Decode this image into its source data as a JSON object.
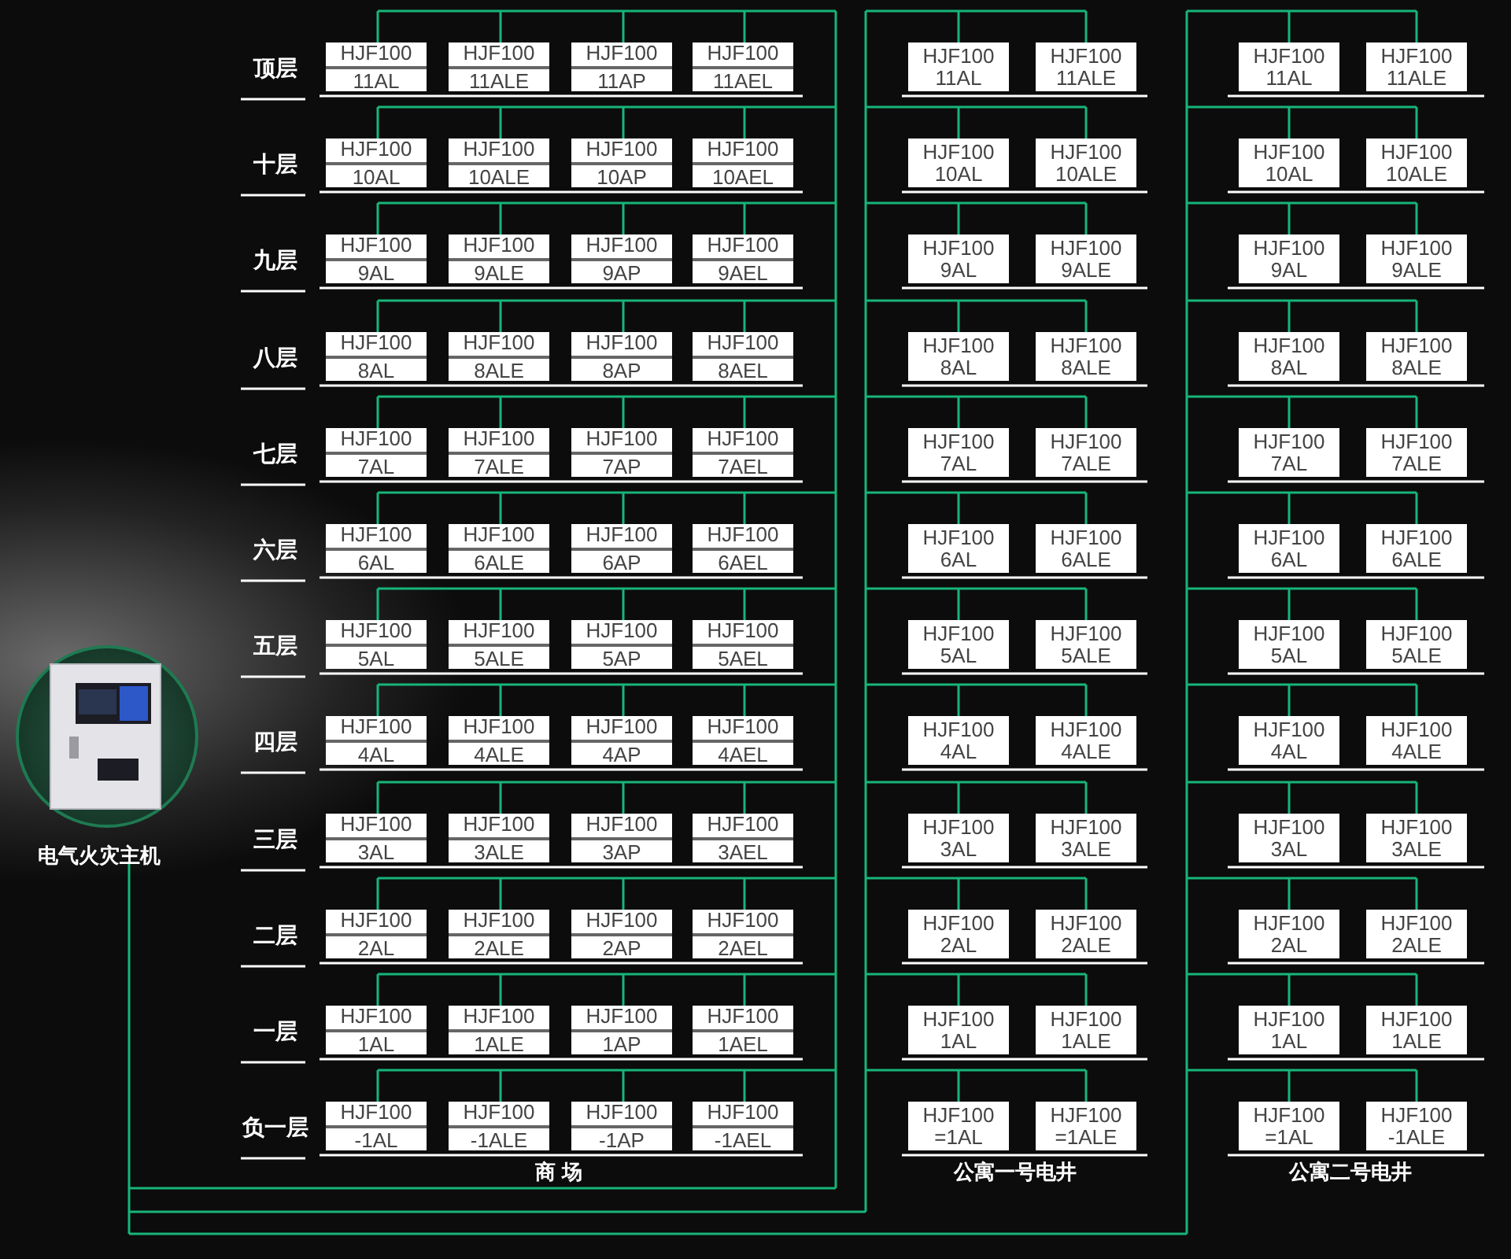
{
  "host": {
    "label": "电气火灾主机"
  },
  "sections": {
    "mall": "商 场",
    "apartment_1": "公寓一号电井",
    "apartment_2": "公寓二号电井"
  },
  "floors": [
    {
      "label": "顶层",
      "mall": [
        {
          "model": "HJF100",
          "code": "11AL"
        },
        {
          "model": "HJF100",
          "code": "11ALE"
        },
        {
          "model": "HJF100",
          "code": "11AP"
        },
        {
          "model": "HJF100",
          "code": "11AEL"
        }
      ],
      "apartment_1": [
        {
          "model": "HJF100",
          "code": "11AL"
        },
        {
          "model": "HJF100",
          "code": "11ALE"
        }
      ],
      "apartment_2": [
        {
          "model": "HJF100",
          "code": "11AL"
        },
        {
          "model": "HJF100",
          "code": "11ALE"
        }
      ]
    },
    {
      "label": "十层",
      "mall": [
        {
          "model": "HJF100",
          "code": "10AL"
        },
        {
          "model": "HJF100",
          "code": "10ALE"
        },
        {
          "model": "HJF100",
          "code": "10AP"
        },
        {
          "model": "HJF100",
          "code": "10AEL"
        }
      ],
      "apartment_1": [
        {
          "model": "HJF100",
          "code": "10AL"
        },
        {
          "model": "HJF100",
          "code": "10ALE"
        }
      ],
      "apartment_2": [
        {
          "model": "HJF100",
          "code": "10AL"
        },
        {
          "model": "HJF100",
          "code": "10ALE"
        }
      ]
    },
    {
      "label": "九层",
      "mall": [
        {
          "model": "HJF100",
          "code": "9AL"
        },
        {
          "model": "HJF100",
          "code": "9ALE"
        },
        {
          "model": "HJF100",
          "code": "9AP"
        },
        {
          "model": "HJF100",
          "code": "9AEL"
        }
      ],
      "apartment_1": [
        {
          "model": "HJF100",
          "code": "9AL"
        },
        {
          "model": "HJF100",
          "code": "9ALE"
        }
      ],
      "apartment_2": [
        {
          "model": "HJF100",
          "code": "9AL"
        },
        {
          "model": "HJF100",
          "code": "9ALE"
        }
      ]
    },
    {
      "label": "八层",
      "mall": [
        {
          "model": "HJF100",
          "code": "8AL"
        },
        {
          "model": "HJF100",
          "code": "8ALE"
        },
        {
          "model": "HJF100",
          "code": "8AP"
        },
        {
          "model": "HJF100",
          "code": "8AEL"
        }
      ],
      "apartment_1": [
        {
          "model": "HJF100",
          "code": "8AL"
        },
        {
          "model": "HJF100",
          "code": "8ALE"
        }
      ],
      "apartment_2": [
        {
          "model": "HJF100",
          "code": "8AL"
        },
        {
          "model": "HJF100",
          "code": "8ALE"
        }
      ]
    },
    {
      "label": "七层",
      "mall": [
        {
          "model": "HJF100",
          "code": "7AL"
        },
        {
          "model": "HJF100",
          "code": "7ALE"
        },
        {
          "model": "HJF100",
          "code": "7AP"
        },
        {
          "model": "HJF100",
          "code": "7AEL"
        }
      ],
      "apartment_1": [
        {
          "model": "HJF100",
          "code": "7AL"
        },
        {
          "model": "HJF100",
          "code": "7ALE"
        }
      ],
      "apartment_2": [
        {
          "model": "HJF100",
          "code": "7AL"
        },
        {
          "model": "HJF100",
          "code": "7ALE"
        }
      ]
    },
    {
      "label": "六层",
      "mall": [
        {
          "model": "HJF100",
          "code": "6AL"
        },
        {
          "model": "HJF100",
          "code": "6ALE"
        },
        {
          "model": "HJF100",
          "code": "6AP"
        },
        {
          "model": "HJF100",
          "code": "6AEL"
        }
      ],
      "apartment_1": [
        {
          "model": "HJF100",
          "code": "6AL"
        },
        {
          "model": "HJF100",
          "code": "6ALE"
        }
      ],
      "apartment_2": [
        {
          "model": "HJF100",
          "code": "6AL"
        },
        {
          "model": "HJF100",
          "code": "6ALE"
        }
      ]
    },
    {
      "label": "五层",
      "mall": [
        {
          "model": "HJF100",
          "code": "5AL"
        },
        {
          "model": "HJF100",
          "code": "5ALE"
        },
        {
          "model": "HJF100",
          "code": "5AP"
        },
        {
          "model": "HJF100",
          "code": "5AEL"
        }
      ],
      "apartment_1": [
        {
          "model": "HJF100",
          "code": "5AL"
        },
        {
          "model": "HJF100",
          "code": "5ALE"
        }
      ],
      "apartment_2": [
        {
          "model": "HJF100",
          "code": "5AL"
        },
        {
          "model": "HJF100",
          "code": "5ALE"
        }
      ]
    },
    {
      "label": "四层",
      "mall": [
        {
          "model": "HJF100",
          "code": "4AL"
        },
        {
          "model": "HJF100",
          "code": "4ALE"
        },
        {
          "model": "HJF100",
          "code": "4AP"
        },
        {
          "model": "HJF100",
          "code": "4AEL"
        }
      ],
      "apartment_1": [
        {
          "model": "HJF100",
          "code": "4AL"
        },
        {
          "model": "HJF100",
          "code": "4ALE"
        }
      ],
      "apartment_2": [
        {
          "model": "HJF100",
          "code": "4AL"
        },
        {
          "model": "HJF100",
          "code": "4ALE"
        }
      ]
    },
    {
      "label": "三层",
      "mall": [
        {
          "model": "HJF100",
          "code": "3AL"
        },
        {
          "model": "HJF100",
          "code": "3ALE"
        },
        {
          "model": "HJF100",
          "code": "3AP"
        },
        {
          "model": "HJF100",
          "code": "3AEL"
        }
      ],
      "apartment_1": [
        {
          "model": "HJF100",
          "code": "3AL"
        },
        {
          "model": "HJF100",
          "code": "3ALE"
        }
      ],
      "apartment_2": [
        {
          "model": "HJF100",
          "code": "3AL"
        },
        {
          "model": "HJF100",
          "code": "3ALE"
        }
      ]
    },
    {
      "label": "二层",
      "mall": [
        {
          "model": "HJF100",
          "code": "2AL"
        },
        {
          "model": "HJF100",
          "code": "2ALE"
        },
        {
          "model": "HJF100",
          "code": "2AP"
        },
        {
          "model": "HJF100",
          "code": "2AEL"
        }
      ],
      "apartment_1": [
        {
          "model": "HJF100",
          "code": "2AL"
        },
        {
          "model": "HJF100",
          "code": "2ALE"
        }
      ],
      "apartment_2": [
        {
          "model": "HJF100",
          "code": "2AL"
        },
        {
          "model": "HJF100",
          "code": "2ALE"
        }
      ]
    },
    {
      "label": "一层",
      "mall": [
        {
          "model": "HJF100",
          "code": "1AL"
        },
        {
          "model": "HJF100",
          "code": "1ALE"
        },
        {
          "model": "HJF100",
          "code": "1AP"
        },
        {
          "model": "HJF100",
          "code": "1AEL"
        }
      ],
      "apartment_1": [
        {
          "model": "HJF100",
          "code": "1AL"
        },
        {
          "model": "HJF100",
          "code": "1ALE"
        }
      ],
      "apartment_2": [
        {
          "model": "HJF100",
          "code": "1AL"
        },
        {
          "model": "HJF100",
          "code": "1ALE"
        }
      ]
    },
    {
      "label": "负一层",
      "mall": [
        {
          "model": "HJF100",
          "code": "-1AL"
        },
        {
          "model": "HJF100",
          "code": "-1ALE"
        },
        {
          "model": "HJF100",
          "code": "-1AP"
        },
        {
          "model": "HJF100",
          "code": "-1AEL"
        }
      ],
      "apartment_1": [
        {
          "model": "HJF100",
          "code": "=1AL"
        },
        {
          "model": "HJF100",
          "code": "=1ALE"
        }
      ],
      "apartment_2": [
        {
          "model": "HJF100",
          "code": "=1AL"
        },
        {
          "model": "HJF100",
          "code": "-1ALE"
        }
      ]
    }
  ]
}
